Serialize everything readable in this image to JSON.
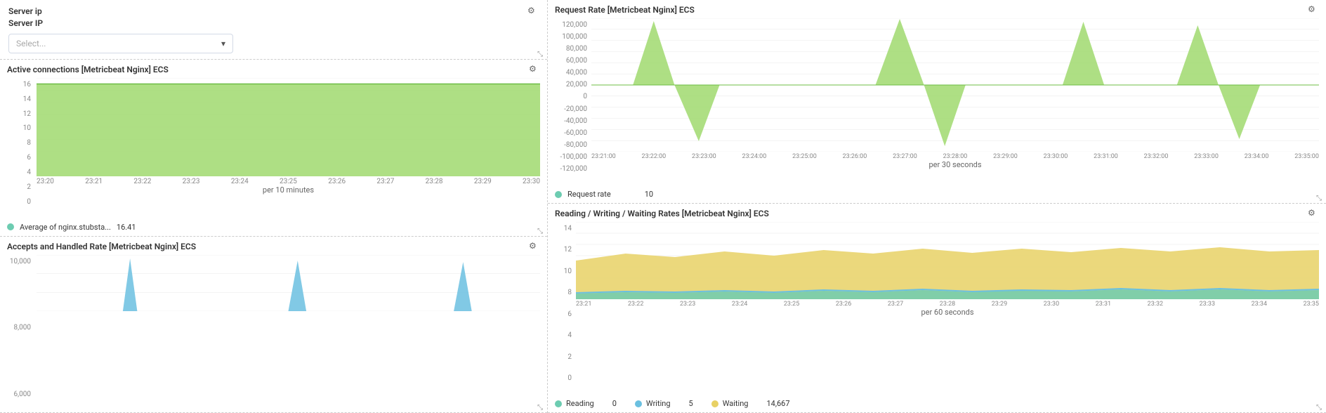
{
  "left": {
    "serverIp": {
      "sectionTitle": "Server ip",
      "label": "Server IP",
      "selectPlaceholder": "Select..."
    },
    "activeConnections": {
      "title": "Active connections [Metricbeat Nginx] ECS",
      "yLabels": [
        "16",
        "14",
        "12",
        "10",
        "8",
        "6",
        "4",
        "2",
        "0"
      ],
      "xLabels": [
        "23:20",
        "23:21",
        "23:22",
        "23:23",
        "23:24",
        "23:25",
        "23:26",
        "23:27",
        "23:28",
        "23:29",
        "23:30"
      ],
      "xAxisLabel": "per 10 minutes",
      "legendLabel": "Average of nginx.stubsta...",
      "legendValue": "16.41"
    },
    "acceptsHandled": {
      "title": "Accepts and Handled Rate [Metricbeat Nginx] ECS",
      "yLabels": [
        "10,000",
        "8,000",
        "6,000"
      ],
      "xLabels": []
    }
  },
  "right": {
    "requestRate": {
      "title": "Request Rate [Metricbeat Nginx] ECS",
      "yLabels": [
        "120,000",
        "100,000",
        "80,000",
        "60,000",
        "40,000",
        "20,000",
        "0",
        "-20,000",
        "-40,000",
        "-60,000",
        "-80,000",
        "-100,000",
        "-120,000"
      ],
      "xLabels": [
        "23:21:00",
        "23:22:00",
        "23:23:00",
        "23:24:00",
        "23:25:00",
        "23:26:00",
        "23:27:00",
        "23:28:00",
        "23:29:00",
        "23:30:00",
        "23:31:00",
        "23:32:00",
        "23:33:00",
        "23:34:00",
        "23:35:00"
      ],
      "xAxisLabel": "per 30 seconds",
      "legendLabel": "Request rate",
      "legendValue": "10"
    },
    "rwwRates": {
      "title": "Reading / Writing / Waiting Rates [Metricbeat Nginx] ECS",
      "yLabels": [
        "14",
        "12",
        "10",
        "8",
        "6",
        "4",
        "2",
        "0"
      ],
      "xLabels": [
        "23:21",
        "23:22",
        "23:23",
        "23:24",
        "23:25",
        "23:26",
        "23:27",
        "23:28",
        "23:29",
        "23:30",
        "23:31",
        "23:32",
        "23:33",
        "23:34",
        "23:35"
      ],
      "xAxisLabel": "per 60 seconds",
      "readingLabel": "Reading",
      "readingValue": "0",
      "writingLabel": "Writing",
      "writingValue": "5",
      "waitingLabel": "Waiting",
      "waitingValue": "14,667"
    }
  },
  "icons": {
    "gear": "⚙",
    "chevronDown": "▾",
    "resize": "⤡"
  }
}
